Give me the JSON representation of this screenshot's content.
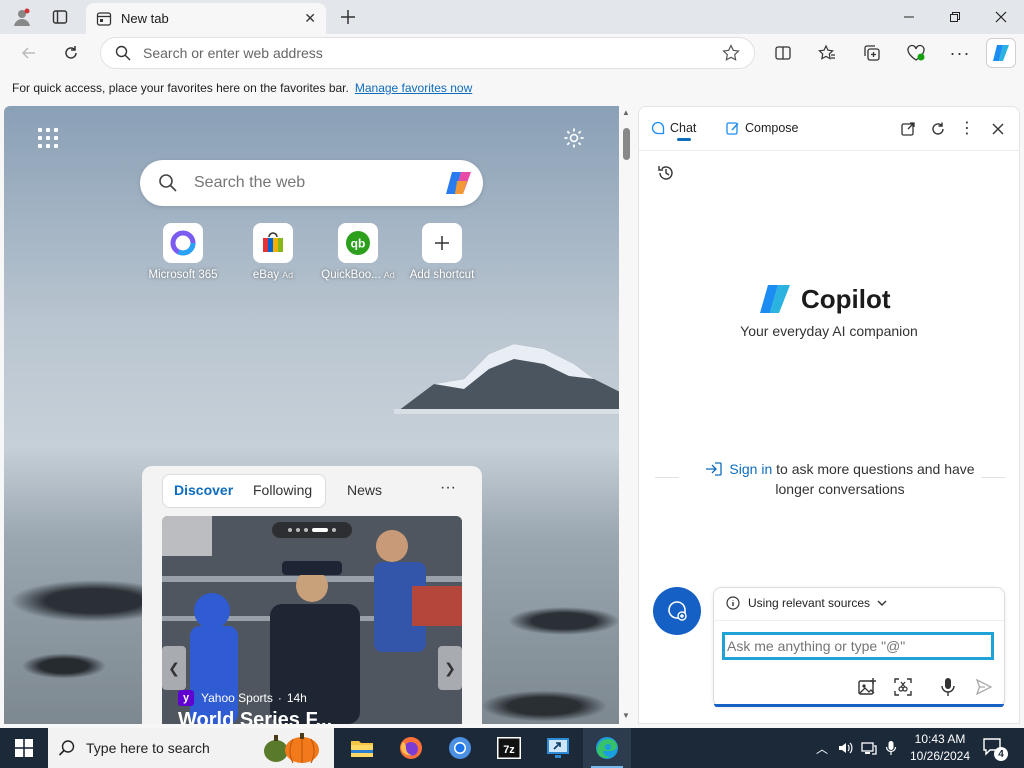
{
  "browser": {
    "tab_title": "New tab",
    "address_placeholder": "Search or enter web address",
    "favorites_bar_text": "For quick access, place your favorites here on the favorites bar.",
    "favorites_bar_link": "Manage favorites now"
  },
  "newtab": {
    "search_placeholder": "Search the web",
    "shortcuts": [
      {
        "label": "Microsoft 365",
        "ad": ""
      },
      {
        "label": "eBay",
        "ad": "Ad"
      },
      {
        "label": "QuickBoo...",
        "ad": "Ad"
      },
      {
        "label": "Add shortcut",
        "ad": ""
      }
    ],
    "feed_tabs": [
      "Discover",
      "Following",
      "News"
    ],
    "feed_more": "···",
    "feed_card": {
      "source": "Yahoo Sports",
      "age": "14h",
      "headline": "World Series F..."
    }
  },
  "copilot": {
    "tabs": [
      "Chat",
      "Compose"
    ],
    "brand": "Copilot",
    "tagline": "Your everyday AI companion",
    "signin_link": "Sign in",
    "signin_rest": " to ask more questions and have longer conversations",
    "sources_label": "Using relevant sources",
    "input_placeholder": "Ask me anything or type \"@\""
  },
  "taskbar": {
    "search_placeholder": "Type here to search",
    "time": "10:43 AM",
    "date": "10/26/2024",
    "notification_count": "4"
  },
  "colors": {
    "accent": "#0f6cbd",
    "copilot_button": "#1560c4",
    "taskbar": "#1c2939",
    "input_focus": "#1fa3d6"
  }
}
